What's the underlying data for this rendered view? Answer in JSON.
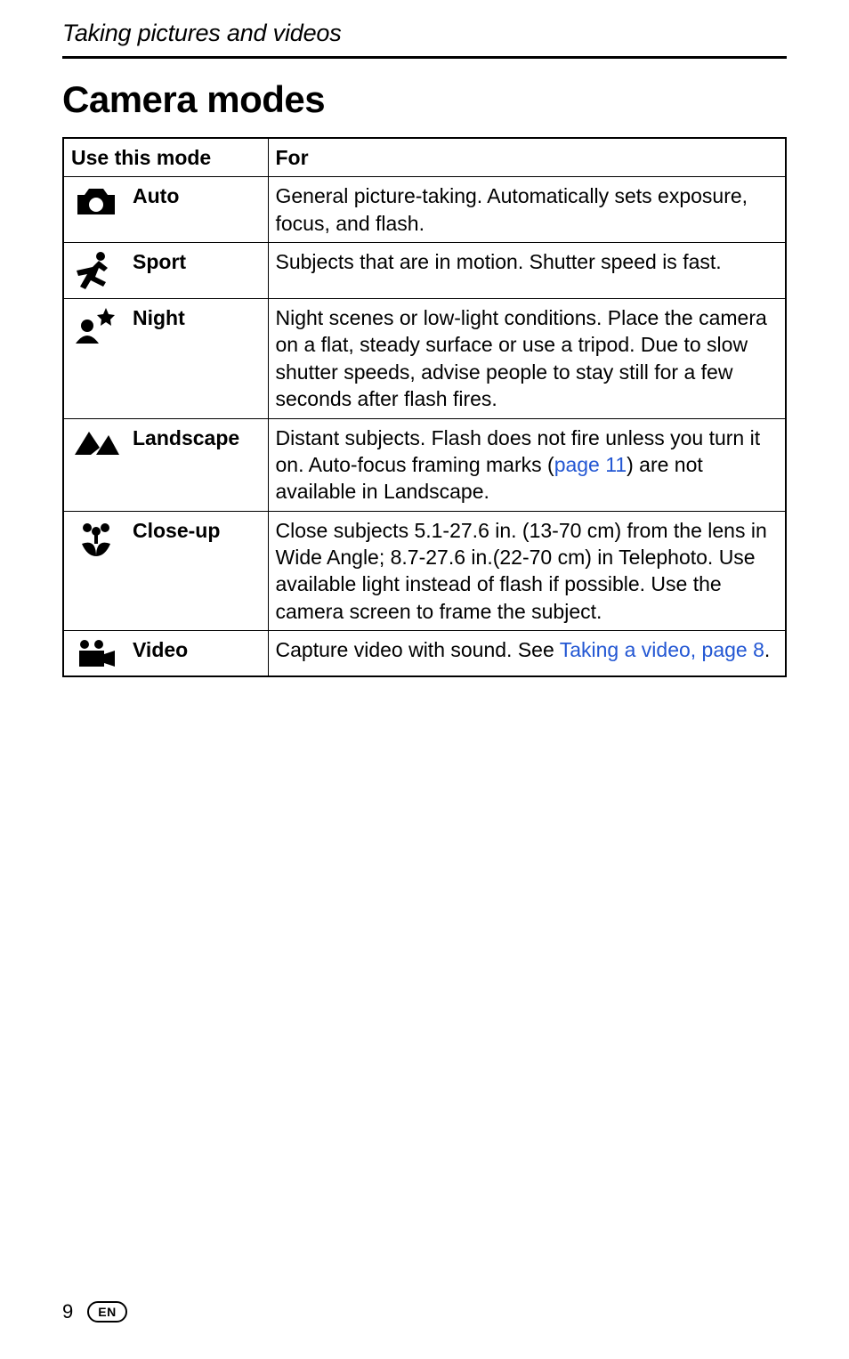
{
  "running_header": "Taking pictures and videos",
  "title": "Camera modes",
  "table": {
    "header_mode": "Use this mode",
    "header_for": "For",
    "rows": [
      {
        "label": "Auto",
        "desc_pre": "General picture-taking. Automatically sets exposure, focus, and flash.",
        "link": "",
        "desc_post": ""
      },
      {
        "label": "Sport",
        "desc_pre": "Subjects that are in motion. Shutter speed is fast.",
        "link": "",
        "desc_post": ""
      },
      {
        "label": "Night",
        "desc_pre": "Night scenes or low-light conditions. Place the camera on a flat, steady surface or use a tripod. Due to slow shutter speeds, advise people to stay still for a few seconds after flash fires.",
        "link": "",
        "desc_post": ""
      },
      {
        "label": "Landscape",
        "desc_pre": "Distant subjects. Flash does not fire unless you turn it on. Auto-focus framing marks (",
        "link": "page 11",
        "desc_post": ") are not available in Landscape."
      },
      {
        "label": "Close-up",
        "desc_pre": "Close subjects 5.1-27.6 in. (13-70 cm) from the lens in Wide Angle; 8.7-27.6 in.(22-70 cm) in Telephoto. Use available light instead of flash if possible. Use the camera screen to frame the subject.",
        "link": "",
        "desc_post": ""
      },
      {
        "label": "Video",
        "desc_pre": "Capture video with sound. See ",
        "link": "Taking a video, page 8",
        "desc_post": "."
      }
    ]
  },
  "footer_page_number": "9",
  "footer_lang_pill": "EN"
}
